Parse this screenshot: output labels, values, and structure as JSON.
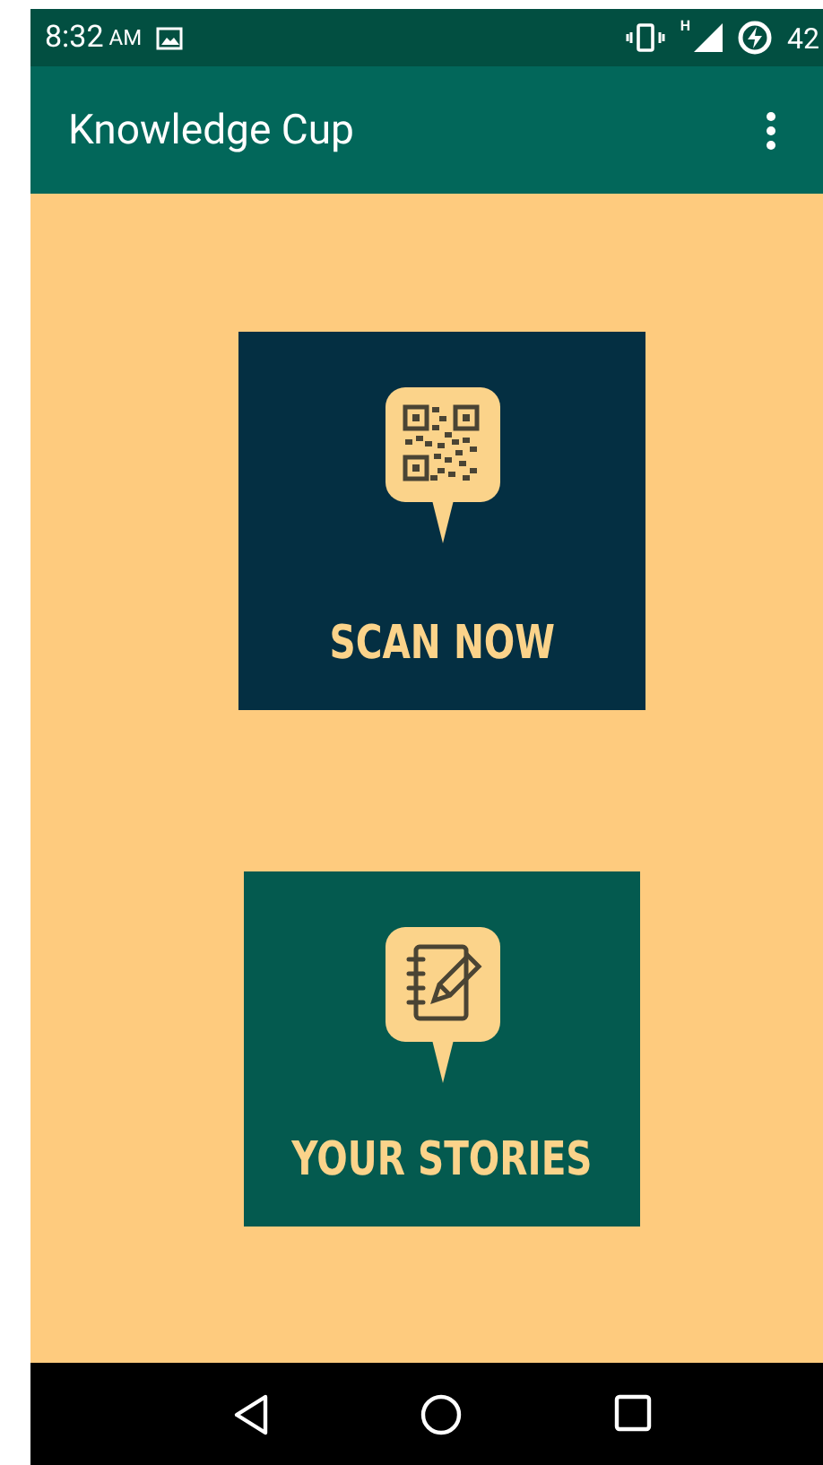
{
  "status_bar": {
    "time": "8:32",
    "meridiem": "AM",
    "network": "H",
    "battery": "42"
  },
  "app_bar": {
    "title": "Knowledge Cup"
  },
  "tiles": [
    {
      "kind": "scan",
      "label": "SCAN NOW",
      "color": "#042f42"
    },
    {
      "kind": "stories",
      "label": "YOUR STORIES",
      "color": "#045a4f"
    }
  ]
}
